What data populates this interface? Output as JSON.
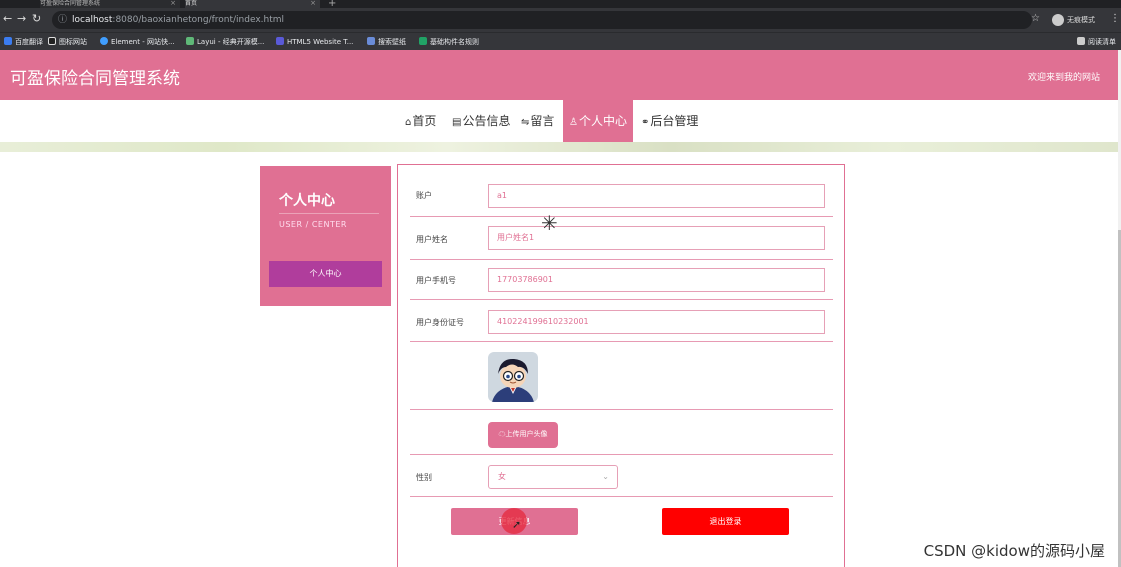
{
  "browser": {
    "tabs": [
      {
        "title": "可盈保险合同管理系统",
        "close": "×"
      },
      {
        "title": "首页",
        "close": "×"
      }
    ],
    "new_tab": "+",
    "url_host": "localhost",
    "url_rest": ":8080/baoxianhetong/front/index.html",
    "profile_label": "无痕模式",
    "bookmarks": [
      "百度翻译",
      "图标网站",
      "Element - 网站快...",
      "Layui - 经典开源模...",
      "HTML5 Website T...",
      "搜索壁纸",
      "基础构件名规则"
    ],
    "reading_list": "阅读清单"
  },
  "header": {
    "site_title": "可盈保险合同管理系统",
    "welcome": "欢迎来到我的网站"
  },
  "nav": {
    "items": [
      {
        "icon": "⌂",
        "label": "首页"
      },
      {
        "icon": "▤",
        "label": "公告信息"
      },
      {
        "icon": "⇋",
        "label": "留言"
      },
      {
        "icon": "♙",
        "label": "个人中心"
      },
      {
        "icon": "⚭",
        "label": "后台管理"
      }
    ]
  },
  "sidebar": {
    "title": "个人中心",
    "subtitle": "USER / CENTER",
    "menu_button": "个人中心"
  },
  "form": {
    "account": {
      "label": "账户",
      "value": "a1"
    },
    "username": {
      "label": "用户姓名",
      "value": "用户姓名1"
    },
    "phone": {
      "label": "用户手机号",
      "value": "17703786901"
    },
    "idcard": {
      "label": "用户身份证号",
      "value": "410224199610232001"
    },
    "upload_button": "上传用户头像",
    "gender": {
      "label": "性别",
      "value": "女"
    },
    "update_button": "更新信息",
    "logout_button": "退出登录"
  },
  "watermark": "CSDN @kidow的源码小屋",
  "colors": {
    "primary": "#e07093",
    "sidebar_button": "#b03d9c",
    "logout": "#ff0000"
  }
}
